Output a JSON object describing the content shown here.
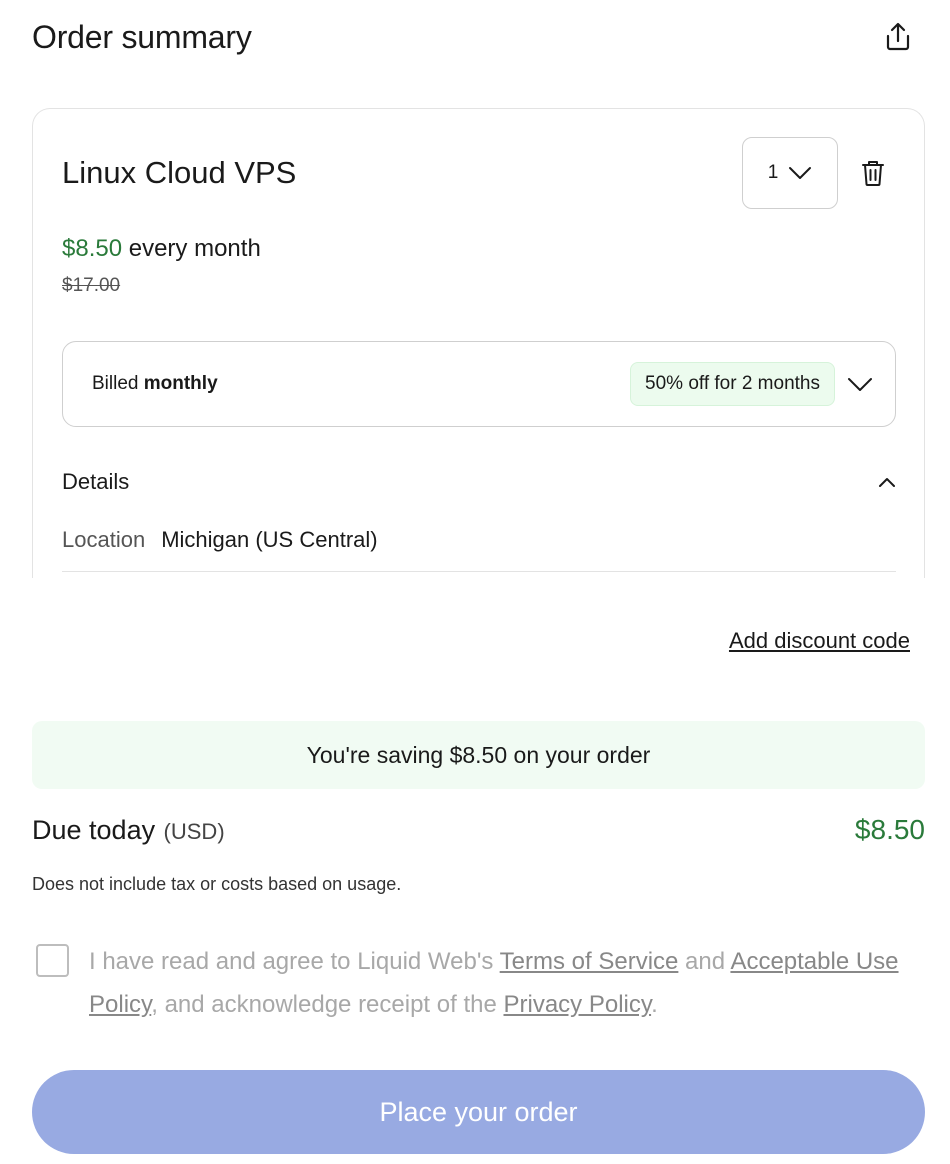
{
  "header": {
    "title": "Order summary"
  },
  "product": {
    "name": "Linux Cloud VPS",
    "quantity": "1",
    "price": "$8.50",
    "period": " every month",
    "original_price": "$17.00"
  },
  "billing": {
    "prefix": "Billed ",
    "term": "monthly",
    "promo": "50% off for 2 months"
  },
  "details": {
    "title": "Details",
    "location_label": "Location",
    "location_value": "Michigan (US Central)"
  },
  "discount": {
    "link": "Add discount code"
  },
  "savings": {
    "text": "You're saving $8.50 on your order"
  },
  "due": {
    "label": "Due today",
    "currency": "(USD)",
    "amount": "$8.50",
    "note": "Does not include tax or costs based on usage."
  },
  "agreement": {
    "part1": "I have read and agree to Liquid Web's ",
    "tos": "Terms of Service",
    "part2": " and ",
    "aup": "Acceptable Use Policy",
    "part3": ", and acknowledge receipt of the ",
    "privacy": "Privacy Policy",
    "part4": "."
  },
  "cta": {
    "label": "Place your order"
  },
  "colors": {
    "accent_green": "#2a7a3a",
    "button": "#98aae2",
    "banner": "#f1fbf3"
  }
}
